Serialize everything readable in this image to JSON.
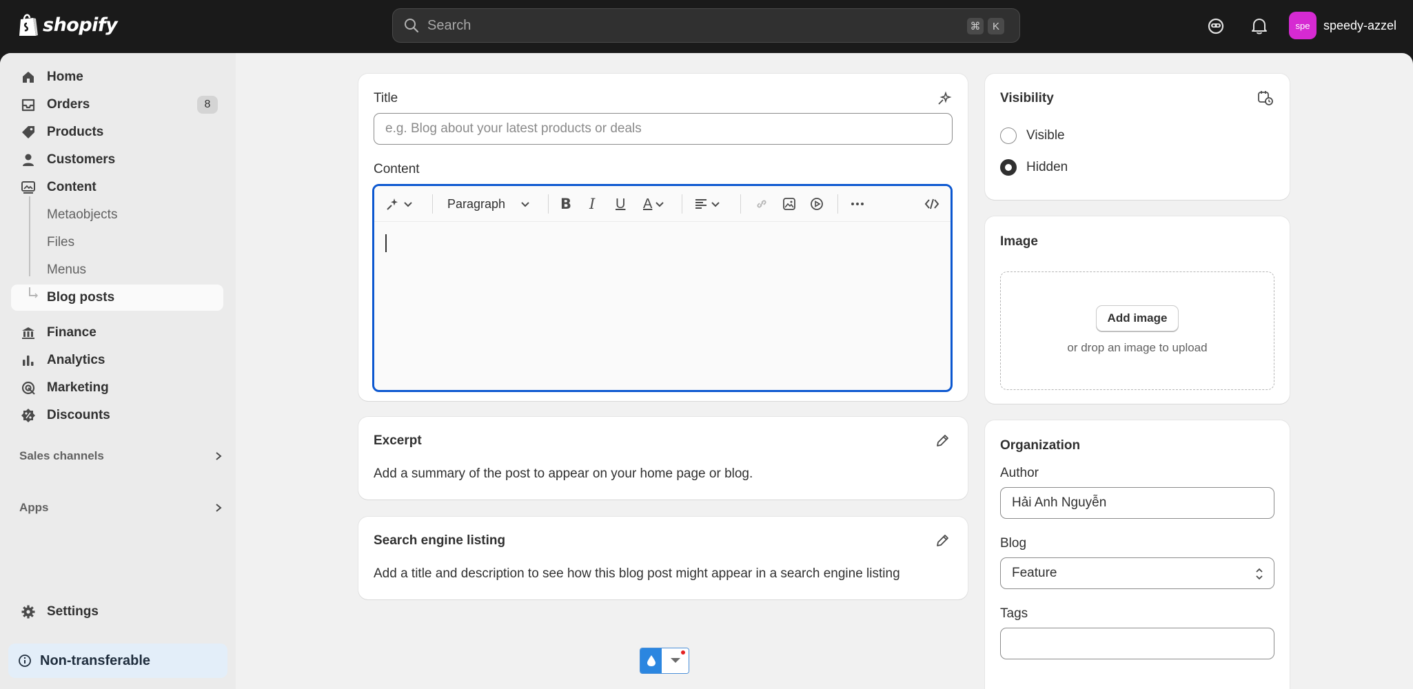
{
  "topbar": {
    "logo_text": "shopify",
    "search_placeholder": "Search",
    "shortcut_cmd": "⌘",
    "shortcut_key": "K",
    "avatar_initials": "spe",
    "store_name": "speedy-azzel"
  },
  "sidebar": {
    "items": [
      {
        "label": "Home",
        "icon": "home-icon"
      },
      {
        "label": "Orders",
        "icon": "inbox-icon",
        "badge": "8"
      },
      {
        "label": "Products",
        "icon": "tag-icon"
      },
      {
        "label": "Customers",
        "icon": "person-icon"
      },
      {
        "label": "Content",
        "icon": "image-icon"
      }
    ],
    "content_sub": [
      "Metaobjects",
      "Files",
      "Menus",
      "Blog posts"
    ],
    "items2": [
      {
        "label": "Finance",
        "icon": "bank-icon"
      },
      {
        "label": "Analytics",
        "icon": "bar-chart-icon"
      },
      {
        "label": "Marketing",
        "icon": "target-icon"
      },
      {
        "label": "Discounts",
        "icon": "discount-icon"
      }
    ],
    "sales_channels": "Sales channels",
    "apps": "Apps",
    "settings": "Settings",
    "non_transferable": "Non-transferable"
  },
  "main": {
    "title_label": "Title",
    "title_placeholder": "e.g. Blog about your latest products or deals",
    "content_label": "Content",
    "paragraph_select": "Paragraph",
    "excerpt_title": "Excerpt",
    "excerpt_desc": "Add a summary of the post to appear on your home page or blog.",
    "seo_title": "Search engine listing",
    "seo_desc": "Add a title and description to see how this blog post might appear in a search engine listing"
  },
  "visibility": {
    "title": "Visibility",
    "options": [
      "Visible",
      "Hidden"
    ],
    "selected": "Hidden"
  },
  "image": {
    "title": "Image",
    "add_button": "Add image",
    "drop_text": "or drop an image to upload"
  },
  "organization": {
    "title": "Organization",
    "author_label": "Author",
    "author_value": "Hải Anh Nguyễn",
    "blog_label": "Blog",
    "blog_value": "Feature",
    "tags_label": "Tags",
    "tags_value": ""
  }
}
